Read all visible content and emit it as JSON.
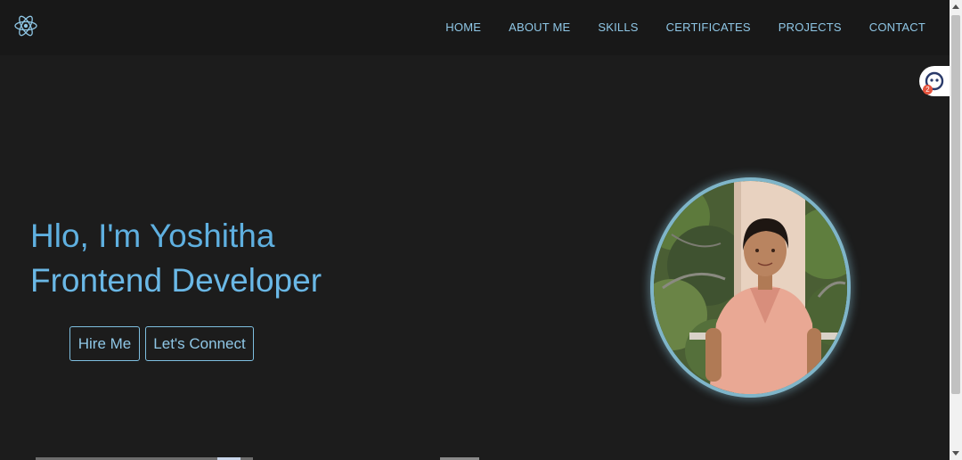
{
  "navbar": {
    "logo_icon": "react-atom-icon",
    "links": [
      "HOME",
      "ABOUT ME",
      "SKILLS",
      "CERTIFICATES",
      "PROJECTS",
      "CONTACT"
    ]
  },
  "chat_widget": {
    "icon": "chat-bot-icon",
    "badge_count": "2"
  },
  "hero": {
    "line1": "Hlo, I'm Yoshitha",
    "line2": "Frontend Developer",
    "hire_button": "Hire Me",
    "connect_button": "Let's Connect"
  },
  "profile_photo": {
    "icon": "profile-photo"
  },
  "colors": {
    "background": "#1c1c1c",
    "navbar": "#181818",
    "accent": "#5fb0e0",
    "nav_text": "#8fc7e6"
  }
}
